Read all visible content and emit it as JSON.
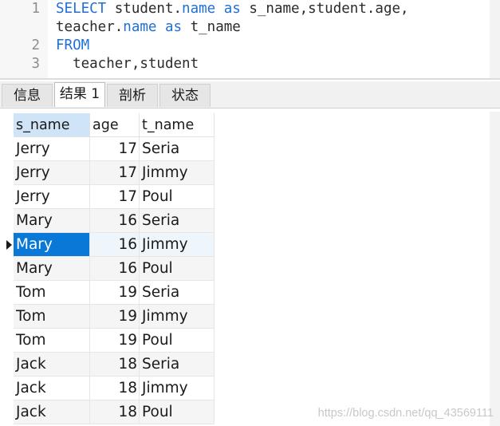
{
  "editor": {
    "lines": [
      {
        "num": "1",
        "parts": [
          {
            "t": "SELECT",
            "kw": true
          },
          {
            "t": " student.",
            "kw": false
          },
          {
            "t": "name",
            "kw": true
          },
          {
            "t": " ",
            "kw": false
          },
          {
            "t": "as",
            "kw": true
          },
          {
            "t": " s_name,student.age,",
            "kw": false
          }
        ]
      },
      {
        "num": "",
        "parts": [
          {
            "t": "teacher.",
            "kw": false
          },
          {
            "t": "name",
            "kw": true
          },
          {
            "t": " ",
            "kw": false
          },
          {
            "t": "as",
            "kw": true
          },
          {
            "t": " t_name",
            "kw": false
          }
        ]
      },
      {
        "num": "2",
        "parts": [
          {
            "t": "FROM",
            "kw": true
          }
        ]
      },
      {
        "num": "3",
        "parts": [
          {
            "t": "  teacher,student",
            "kw": false
          }
        ]
      }
    ],
    "keyword_color": "#1f6fd8"
  },
  "tabs": [
    {
      "label": "信息",
      "active": false
    },
    {
      "label": "结果 1",
      "active": true
    },
    {
      "label": "剖析",
      "active": false
    },
    {
      "label": "状态",
      "active": false
    }
  ],
  "grid": {
    "columns": [
      "s_name",
      "age",
      "t_name"
    ],
    "selected_column": "s_name",
    "current_row_index": 4,
    "rows": [
      {
        "s_name": "Jerry",
        "age": "17",
        "t_name": "Seria"
      },
      {
        "s_name": "Jerry",
        "age": "17",
        "t_name": "Jimmy"
      },
      {
        "s_name": "Jerry",
        "age": "17",
        "t_name": "Poul"
      },
      {
        "s_name": "Mary",
        "age": "16",
        "t_name": "Seria"
      },
      {
        "s_name": "Mary",
        "age": "16",
        "t_name": "Jimmy"
      },
      {
        "s_name": "Mary",
        "age": "16",
        "t_name": "Poul"
      },
      {
        "s_name": "Tom",
        "age": "19",
        "t_name": "Seria"
      },
      {
        "s_name": "Tom",
        "age": "19",
        "t_name": "Jimmy"
      },
      {
        "s_name": "Tom",
        "age": "19",
        "t_name": "Poul"
      },
      {
        "s_name": "Jack",
        "age": "18",
        "t_name": "Seria"
      },
      {
        "s_name": "Jack",
        "age": "18",
        "t_name": "Jimmy"
      },
      {
        "s_name": "Jack",
        "age": "18",
        "t_name": "Poul"
      }
    ],
    "selection_color": "#0a78d7",
    "current_row_icon": "triangle-right-icon"
  },
  "watermark": {
    "text": "https://blog.csdn.net/qq_43569111"
  }
}
